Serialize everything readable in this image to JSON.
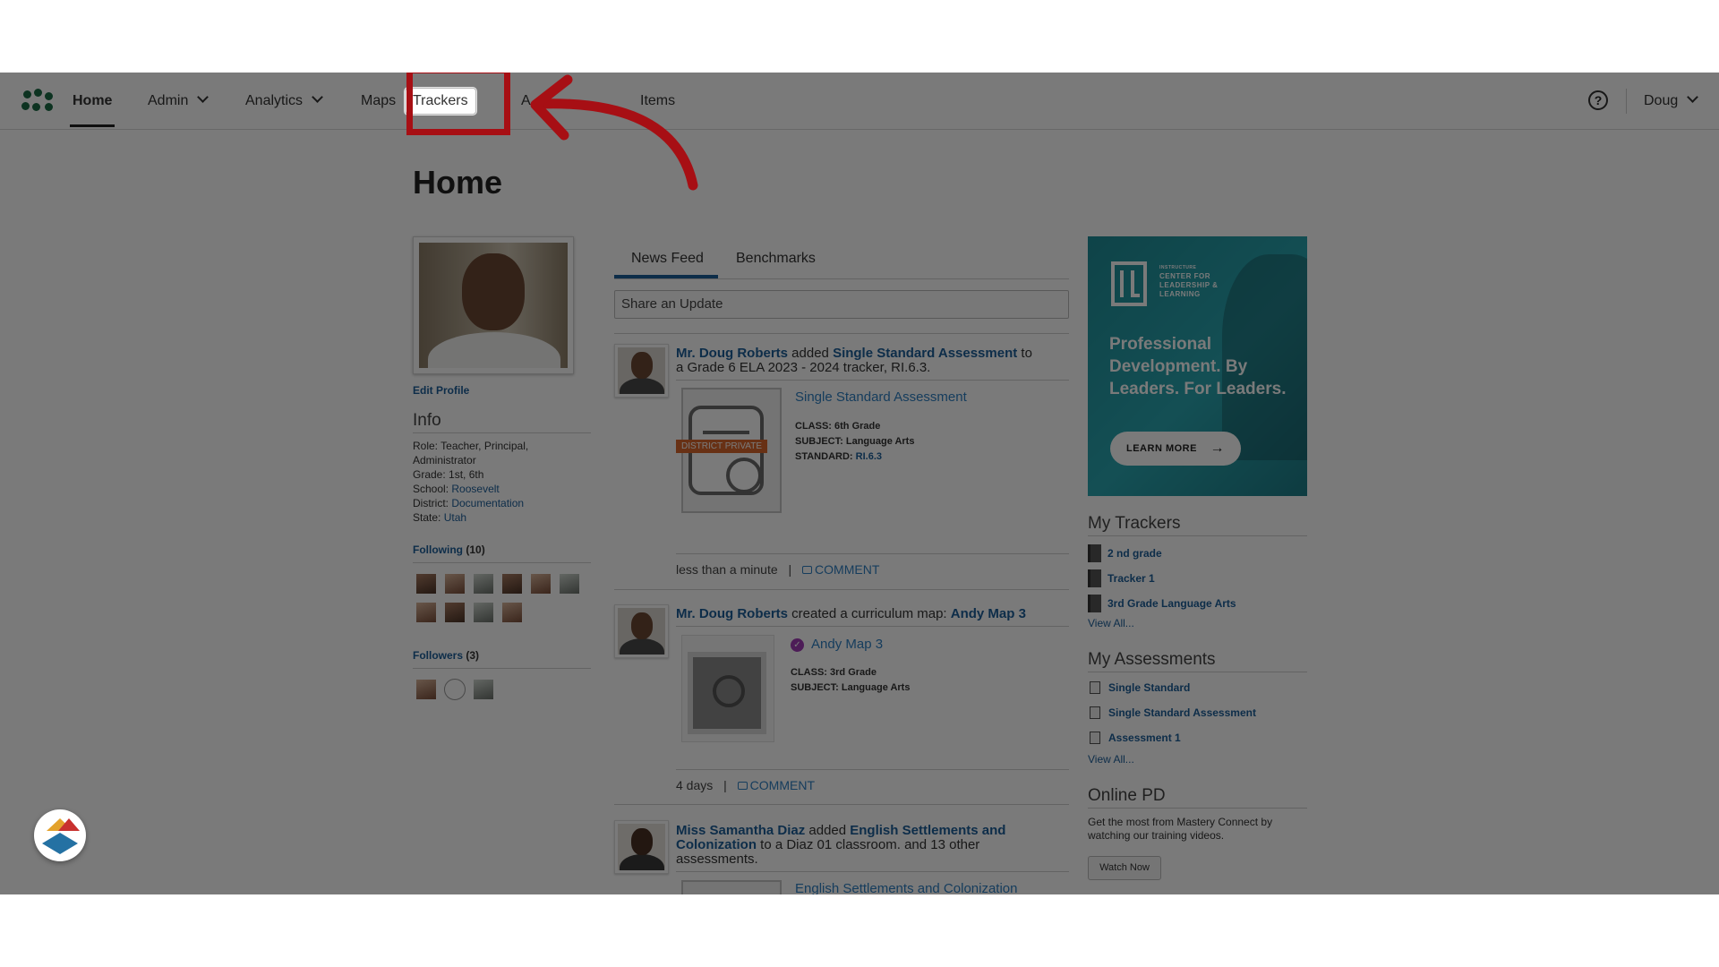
{
  "nav": {
    "home": "Home",
    "admin": "Admin",
    "analytics": "Analytics",
    "maps": "Maps",
    "trackers": "Trackers",
    "hidden_item": "A",
    "items": "Items",
    "help": "?",
    "user": "Doug"
  },
  "page": {
    "title": "Home"
  },
  "profile": {
    "edit": "Edit Profile",
    "info_title": "Info",
    "role_label": "Role:",
    "role": "Teacher, Principal, Administrator",
    "grade_label": "Grade:",
    "grade": "1st, 6th",
    "school_label": "School:",
    "school": "Roosevelt",
    "district_label": "District:",
    "district": "Documentation",
    "state_label": "State:",
    "state": "Utah",
    "following_label": "Following",
    "following_count": "(10)",
    "followers_label": "Followers",
    "followers_count": "(3)"
  },
  "feed": {
    "tabs": [
      "News Feed",
      "Benchmarks"
    ],
    "share_placeholder": "Share an Update",
    "items": [
      {
        "actor": "Mr. Doug Roberts",
        "verb": " added ",
        "object": "Single Standard Assessment",
        "rest": " to a Grade 6 ELA 2023 - 2024 tracker, RI.6.3.",
        "card_title": "Single Standard Assessment",
        "badge": "DISTRICT PRIVATE",
        "class_label": "CLASS:",
        "class_value": "6th Grade",
        "subject_label": "SUBJECT:",
        "subject_value": "Language Arts",
        "standard_label": "STANDARD:",
        "standard_value": "RI.6.3",
        "time": "less than a minute",
        "sep": "|",
        "comment": "COMMENT"
      },
      {
        "actor": "Mr. Doug Roberts",
        "verb": " created a curriculum map: ",
        "object": "Andy Map 3",
        "card_title": "Andy Map 3",
        "class_label": "CLASS:",
        "class_value": "3rd Grade",
        "subject_label": "SUBJECT:",
        "subject_value": "Language Arts",
        "time": "4 days",
        "sep": "|",
        "comment": "COMMENT"
      },
      {
        "actor": "Miss Samantha Diaz",
        "verb": " added ",
        "object": "English Settlements and Colonization",
        "rest": " to a Diaz 01 classroom. and 13 other assessments.",
        "card_title": "English Settlements and Colonization"
      }
    ]
  },
  "ad": {
    "org_small": "INSTRUCTURE",
    "org": "CENTER FOR LEADERSHIP & LEARNING",
    "tagline": "Professional Development. By Leaders. For Leaders.",
    "button": "LEARN MORE",
    "arrow": "→"
  },
  "my_trackers": {
    "title": "My Trackers",
    "items": [
      "2 nd grade",
      "Tracker 1",
      "3rd Grade Language Arts"
    ],
    "view_all": "View All..."
  },
  "my_assessments": {
    "title": "My Assessments",
    "items": [
      "Single Standard",
      "Single Standard Assessment",
      "Assessment 1"
    ],
    "view_all": "View All..."
  },
  "online_pd": {
    "title": "Online PD",
    "text": "Get the most from Mastery Connect by watching our training videos.",
    "button": "Watch Now"
  },
  "colors": {
    "highlight": "#a70f14",
    "link": "#1d5e9a",
    "accent_tab": "#1d5e9a",
    "badge": "#d9672c",
    "ad_bg": "#2aa6b0"
  },
  "icons": [
    "logo-icon",
    "chevron-down-icon",
    "help-icon",
    "comment-icon",
    "check-icon",
    "binder-icon",
    "document-icon",
    "arrow-right-icon",
    "annotation-arrow-icon"
  ]
}
